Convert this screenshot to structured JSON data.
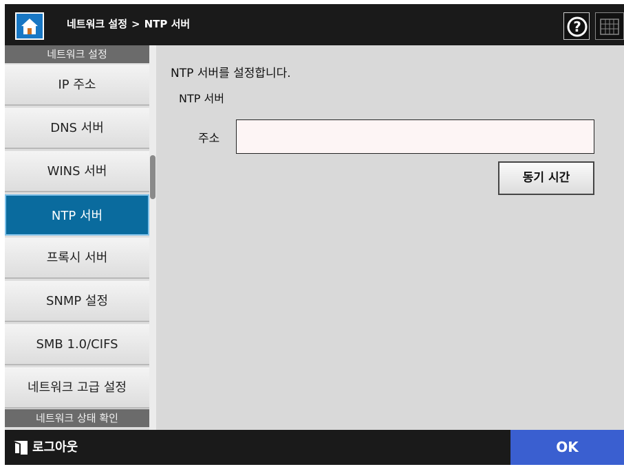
{
  "header": {
    "breadcrumb_parent": "네트워크 설정",
    "breadcrumb_separator": ">",
    "breadcrumb_current": "NTP 서버",
    "help_icon": "help-icon",
    "keyboard_icon": "keyboard-icon",
    "home_icon": "home-icon"
  },
  "sidebar": {
    "section_network": "네트워크 설정",
    "items": [
      {
        "label": "IP 주소"
      },
      {
        "label": "DNS 서버"
      },
      {
        "label": "WINS 서버"
      },
      {
        "label": "NTP 서버",
        "active": true
      },
      {
        "label": "프록시 서버"
      },
      {
        "label": "SNMP 설정"
      },
      {
        "label": "SMB 1.0/CIFS"
      },
      {
        "label": "네트워크 고급 설정"
      }
    ],
    "section_status": "네트워크 상태 확인"
  },
  "main": {
    "intro": "NTP 서버를 설정합니다.",
    "section_label": "NTP 서버",
    "address_label": "주소",
    "address_value": "",
    "sync_button": "동기 시간"
  },
  "footer": {
    "logout_label": "로그아웃",
    "ok_label": "OK"
  },
  "colors": {
    "header_bg": "#1a1a1a",
    "active_item": "#0a6b9e",
    "ok_button": "#3a5fd0",
    "home_button": "#1877c4"
  }
}
